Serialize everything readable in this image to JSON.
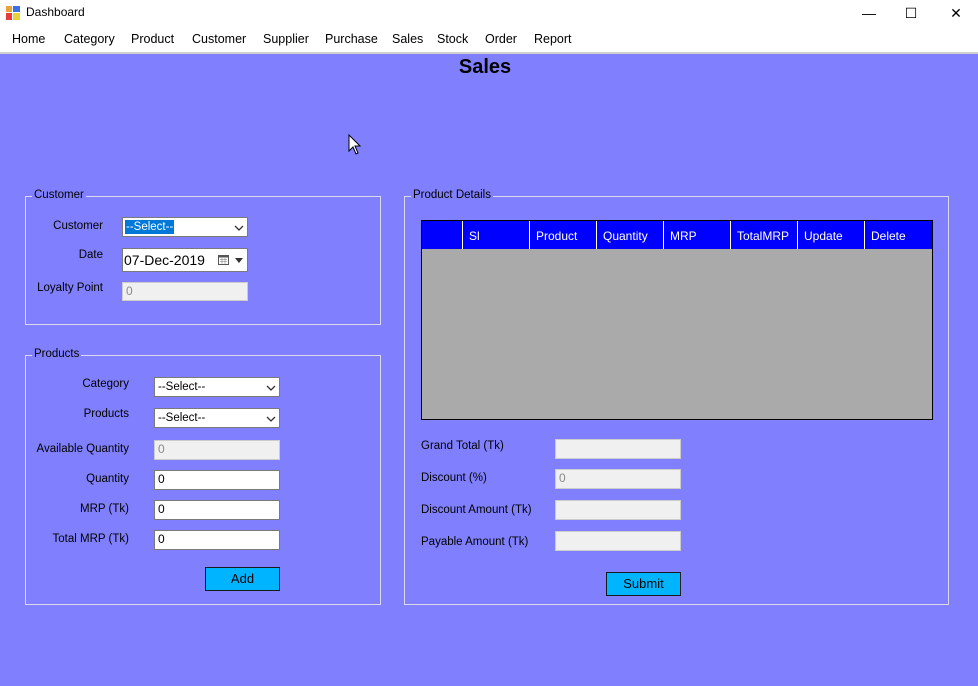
{
  "window": {
    "title": "Dashboard",
    "minimize_glyph": "—",
    "maximize_glyph": "☐",
    "close_glyph": "✕"
  },
  "menu": [
    "Home",
    "Category",
    "Product",
    "Customer",
    "Supplier",
    "Purchase",
    "Sales",
    "Stock",
    "Order",
    "Report"
  ],
  "page": {
    "title": "Sales"
  },
  "customer_group": {
    "legend": "Customer",
    "customer_label": "Customer",
    "customer_value": "--Select--",
    "date_label": "Date",
    "date_value": "07-Dec-2019",
    "loyalty_label": "Loyalty Point",
    "loyalty_value": "0"
  },
  "products_group": {
    "legend": "Products",
    "category_label": "Category",
    "category_value": "--Select--",
    "products_label": "Products",
    "products_value": "--Select--",
    "available_label": "Available Quantity",
    "available_value": "0",
    "quantity_label": "Quantity",
    "quantity_value": "0",
    "mrp_label": "MRP (Tk)",
    "mrp_value": "0",
    "total_mrp_label": "Total MRP (Tk)",
    "total_mrp_value": "0",
    "add_button": "Add"
  },
  "details_group": {
    "legend": "Product Details",
    "columns": [
      "",
      "Sl",
      "Product",
      "Quantity",
      "MRP",
      "TotalMRP",
      "Update",
      "Delete"
    ],
    "grand_total_label": "Grand Total (Tk)",
    "grand_total_value": "",
    "discount_label": "Discount (%)",
    "discount_value": "0",
    "discount_amount_label": "Discount Amount (Tk)",
    "discount_amount_value": "",
    "payable_label": "Payable Amount (Tk)",
    "payable_value": "",
    "submit_button": "Submit"
  },
  "colors": {
    "background": "#8080ff",
    "grid_header": "#0000ff",
    "grid_body": "#aaaaaa",
    "button": "#00b4ff"
  },
  "icons": [
    "app-icon",
    "calendar-icon",
    "dropdown-arrow-icon",
    "mouse-cursor-icon"
  ]
}
